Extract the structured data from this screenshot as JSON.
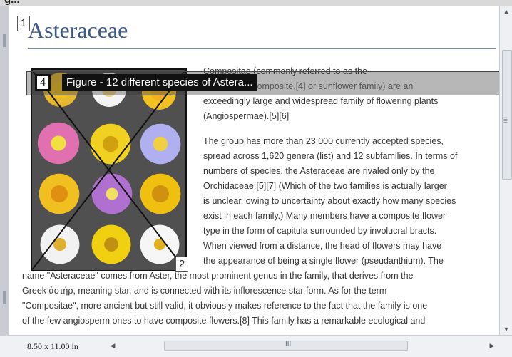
{
  "window": {
    "title_fragment": "g..."
  },
  "document": {
    "title": "Asteraceae",
    "intro_lines": [
      "Compositae (commonly referred to as the",
      "aster, daisy, composite,[4] or sunflower family) are an",
      "exceedingly large and widespread family of flowering plants",
      "(Angiospermae).[5][6]"
    ],
    "body_lines_right": [
      "The group has more than 23,000 currently accepted species,",
      "spread across 1,620 genera (list) and 12 subfamilies. In terms of",
      "numbers of species, the Asteraceae are rivaled only by the",
      "Orchidaceae.[5][7] (Which of the two families is actually larger",
      "is unclear, owing to uncertainty about exactly how many species",
      "exist in each family.) Many members have a composite flower",
      "type in the form of capitula surrounded by involucral bracts.",
      "When viewed from a distance, the head of flowers may have",
      "the appearance of being a single flower (pseudanthium). The"
    ],
    "body_lines_full": [
      "name \"Asteraceae\" comes from Aster, the most prominent genus in the family, that derives from the",
      "Greek ἀστήρ, meaning star, and is connected with its inflorescence star form. As for the term",
      "\"Compositae\", more ancient but still valid, it obviously makes reference to the fact that the family is one",
      "of the few angiosperm ones to have composite flowers.[8] This family has a remarkable ecological and"
    ]
  },
  "labels": {
    "box1": "1",
    "box2": "2",
    "box4": "4"
  },
  "figure": {
    "caption": "Figure - 12 different species of Astera..."
  },
  "status": {
    "page_size": "8.50 x 11.00 in",
    "hscroll_grip": "III"
  },
  "colors": {
    "title": "#3c5a8a",
    "rule": "#6f8bb8",
    "caption_bg": "#111111"
  },
  "icons": [
    "scroll-up-arrow-icon",
    "scroll-down-arrow-icon",
    "scroll-left-arrow-icon",
    "scroll-right-arrow-icon",
    "scroll-grip-icon"
  ]
}
